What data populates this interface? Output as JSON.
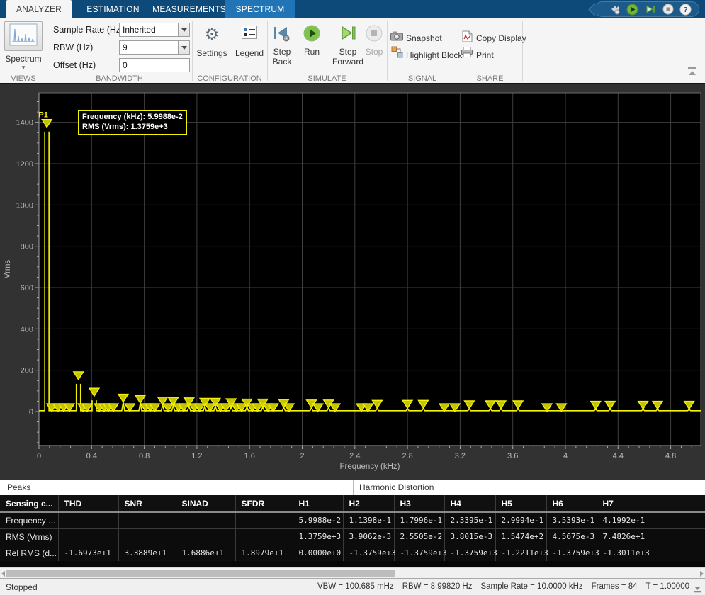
{
  "colors": {
    "tabbar_bg": "#0d4a7a",
    "selected_tab_bg": "#2175b6",
    "trace_yellow": "#f4f400",
    "marker_fill": "#c6c300",
    "plot_bg": "#000000",
    "plot_outer_bg": "#323232",
    "grid": "#3f3f3f"
  },
  "tabs": [
    {
      "label": "ANALYZER",
      "state": "active"
    },
    {
      "label": "ESTIMATION",
      "state": "normal"
    },
    {
      "label": "MEASUREMENTS",
      "state": "normal"
    },
    {
      "label": "SPECTRUM",
      "state": "highlight"
    }
  ],
  "quick_access": {
    "icons": [
      "step-back",
      "run",
      "step-forward",
      "stop",
      "help"
    ]
  },
  "ribbon": {
    "views": {
      "button_label": "Spectrum",
      "section": "VIEWS"
    },
    "bandwidth": {
      "section": "BANDWIDTH",
      "fields": [
        {
          "label": "Sample Rate (Hz)",
          "value": "Inherited",
          "type": "combo"
        },
        {
          "label": "RBW (Hz)",
          "value": "9",
          "type": "combo"
        },
        {
          "label": "Offset (Hz)",
          "value": "0",
          "type": "text"
        }
      ]
    },
    "configuration": {
      "section": "CONFIGURATION",
      "settings_label": "Settings",
      "legend_label": "Legend"
    },
    "simulate": {
      "section": "SIMULATE",
      "step_back_label": "Step Back",
      "run_label": "Run",
      "step_forward_label": "Step Forward",
      "stop_label": "Stop"
    },
    "signal": {
      "section": "SIGNAL",
      "snapshot_label": "Snapshot",
      "highlight_label": "Highlight Block"
    },
    "share": {
      "section": "SHARE",
      "copy_label": "Copy Display",
      "print_label": "Print"
    }
  },
  "tooltip": {
    "line1": "Frequency (kHz): 5.9988e-2",
    "line2": "RMS (Vrms): 1.3759e+3"
  },
  "chart_data": {
    "type": "line",
    "xlabel": "Frequency (kHz)",
    "ylabel": "Vrms",
    "xlim": [
      0,
      5.03
    ],
    "ylim": [
      -165,
      1545
    ],
    "grid": true,
    "x_tick_values": [
      0,
      0.4,
      0.8,
      1.2,
      1.6,
      2,
      2.4,
      2.8,
      3.2,
      3.6,
      4,
      4.4,
      4.8
    ],
    "x_tick_labels": [
      "0",
      "0.4",
      "0.8",
      "1.2",
      "1.6",
      "2",
      "2.4",
      "2.8",
      "3.2",
      "3.6",
      "4",
      "4.4",
      "4.8"
    ],
    "y_tick_values": [
      0,
      200,
      400,
      600,
      800,
      1000,
      1200,
      1400
    ],
    "y_tick_labels": [
      "0",
      "200",
      "400",
      "600",
      "800",
      "1000",
      "1200",
      "1400"
    ],
    "p1": {
      "f": 0.059988,
      "v": 1375.9,
      "label": "P1"
    },
    "peaks": [
      [
        0.06,
        1375.9
      ],
      [
        0.097,
        0
      ],
      [
        0.145,
        0
      ],
      [
        0.188,
        0
      ],
      [
        0.231,
        0
      ],
      [
        0.2999,
        154.7
      ],
      [
        0.334,
        0
      ],
      [
        0.366,
        0
      ],
      [
        0.4199,
        74.8
      ],
      [
        0.458,
        0
      ],
      [
        0.495,
        0
      ],
      [
        0.527,
        0
      ],
      [
        0.565,
        0
      ],
      [
        0.64,
        46
      ],
      [
        0.69,
        0
      ],
      [
        0.77,
        40
      ],
      [
        0.81,
        0
      ],
      [
        0.845,
        0
      ],
      [
        0.88,
        0
      ],
      [
        0.94,
        32
      ],
      [
        0.98,
        0
      ],
      [
        1.02,
        30
      ],
      [
        1.06,
        0
      ],
      [
        1.1,
        0
      ],
      [
        1.14,
        28
      ],
      [
        1.18,
        0
      ],
      [
        1.22,
        0
      ],
      [
        1.26,
        26
      ],
      [
        1.3,
        0
      ],
      [
        1.34,
        26
      ],
      [
        1.38,
        0
      ],
      [
        1.42,
        0
      ],
      [
        1.46,
        24
      ],
      [
        1.5,
        0
      ],
      [
        1.54,
        0
      ],
      [
        1.58,
        22
      ],
      [
        1.62,
        0
      ],
      [
        1.66,
        0
      ],
      [
        1.7,
        22
      ],
      [
        1.74,
        0
      ],
      [
        1.78,
        0
      ],
      [
        1.86,
        20
      ],
      [
        1.9,
        0
      ],
      [
        2.07,
        18
      ],
      [
        2.12,
        0
      ],
      [
        2.2,
        18
      ],
      [
        2.25,
        0
      ],
      [
        2.45,
        0
      ],
      [
        2.5,
        0
      ],
      [
        2.57,
        16
      ],
      [
        2.8,
        16
      ],
      [
        2.92,
        16
      ],
      [
        3.08,
        0
      ],
      [
        3.16,
        0
      ],
      [
        3.27,
        14
      ],
      [
        3.43,
        14
      ],
      [
        3.51,
        14
      ],
      [
        3.64,
        14
      ],
      [
        3.86,
        0
      ],
      [
        3.97,
        0
      ],
      [
        4.23,
        12
      ],
      [
        4.34,
        12
      ],
      [
        4.59,
        12
      ],
      [
        4.7,
        12
      ],
      [
        4.94,
        12
      ]
    ]
  },
  "panels": {
    "left": "Peaks",
    "right": "Harmonic Distortion"
  },
  "table": {
    "headers": [
      "Sensing c...",
      "THD",
      "SNR",
      "SINAD",
      "SFDR",
      "H1",
      "H2",
      "H3",
      "H4",
      "H5",
      "H6",
      "H7"
    ],
    "rows": [
      {
        "label": "Frequency ...",
        "values": [
          "",
          "",
          "",
          "",
          "5.9988e-2",
          "1.1398e-1",
          "1.7996e-1",
          "2.3395e-1",
          "2.9994e-1",
          "3.5393e-1",
          "4.1992e-1"
        ]
      },
      {
        "label": "RMS (Vrms)",
        "values": [
          "",
          "",
          "",
          "",
          "1.3759e+3",
          "3.9062e-3",
          "2.5505e-2",
          "3.8015e-3",
          "1.5474e+2",
          "4.5675e-3",
          "7.4826e+1"
        ]
      },
      {
        "label": "Rel RMS (d...",
        "values": [
          "-1.6973e+1",
          "3.3889e+1",
          "1.6886e+1",
          "1.8979e+1",
          "0.0000e+0",
          "-1.3759e+3",
          "-1.3759e+3",
          "-1.3759e+3",
          "-1.2211e+3",
          "-1.3759e+3",
          "-1.3011e+3"
        ]
      }
    ]
  },
  "statusbar": {
    "left": "Stopped",
    "segments": [
      "VBW = 100.685 mHz",
      "RBW = 8.99820 Hz",
      "Sample Rate = 10.0000 kHz",
      "Frames = 84",
      "T = 1.00000"
    ]
  }
}
